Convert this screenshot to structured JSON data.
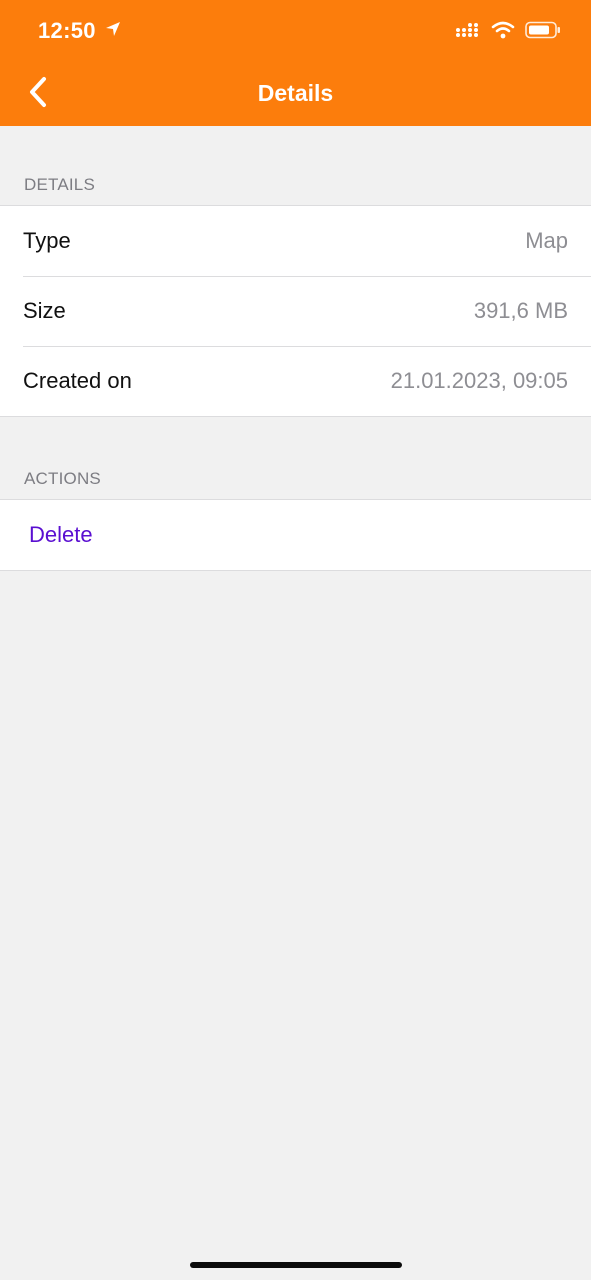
{
  "status_bar": {
    "time": "12:50"
  },
  "nav": {
    "title": "Details"
  },
  "details_section": {
    "header": "DETAILS",
    "rows": [
      {
        "label": "Type",
        "value": "Map"
      },
      {
        "label": "Size",
        "value": "391,6 MB"
      },
      {
        "label": "Created on",
        "value": "21.01.2023, 09:05"
      }
    ]
  },
  "actions_section": {
    "header": "ACTIONS",
    "delete_label": "Delete"
  },
  "colors": {
    "header_bg": "#fc7d0c",
    "delete_text": "#5a0fd1",
    "background": "#f1f1f1"
  }
}
